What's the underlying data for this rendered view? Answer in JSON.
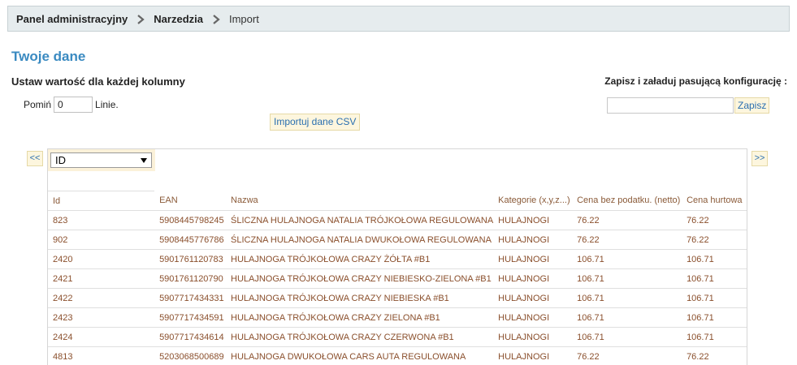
{
  "breadcrumb": {
    "items": [
      {
        "label": "Panel administracyjny",
        "bold": true
      },
      {
        "label": "Narzedzia",
        "bold": true
      },
      {
        "label": "Import",
        "bold": false
      }
    ]
  },
  "page_title": "Twoje dane",
  "columns_section": {
    "label": "Ustaw wartość dla każdej kolumny",
    "skip_prefix": "Pomiń",
    "skip_value": "0",
    "skip_suffix": "Linie."
  },
  "import_button": "Importuj dane CSV",
  "config": {
    "label": "Zapisz i załaduj pasującą konfigurację :",
    "input_value": "",
    "save_label": "Zapisz"
  },
  "navigation": {
    "prev_label": "<<",
    "next_label": ">>"
  },
  "column_select": {
    "selected": "ID"
  },
  "table": {
    "headers": [
      "Id",
      "EAN",
      "Nazwa",
      "Kategorie (x,y,z...)",
      "Cena bez podatku. (netto)",
      "Cena hurtowa"
    ],
    "rows": [
      [
        "823",
        "5908445798245",
        "ŚLICZNA HULAJNOGA NATALIA TRÓJKOŁOWA REGULOWANA",
        "HULAJNOGI",
        "76.22",
        "76.22"
      ],
      [
        "902",
        "5908445776786",
        "ŚLICZNA HULAJNOGA NATALIA DWUKOŁOWA REGULOWANA",
        "HULAJNOGI",
        "76.22",
        "76.22"
      ],
      [
        "2420",
        "5901761120783",
        "HULAJNOGA TRÓJKOŁOWA CRAZY ŻÓŁTA #B1",
        "HULAJNOGI",
        "106.71",
        "106.71"
      ],
      [
        "2421",
        "5901761120790",
        "HULAJNOGA TRÓJKOŁOWA CRAZY NIEBIESKO-ZIELONA #B1",
        "HULAJNOGI",
        "106.71",
        "106.71"
      ],
      [
        "2422",
        "5907717434331",
        "HULAJNOGA TRÓJKOŁOWA CRAZY NIEBIESKA #B1",
        "HULAJNOGI",
        "106.71",
        "106.71"
      ],
      [
        "2423",
        "5907717434591",
        "HULAJNOGA TRÓJKOŁOWA CRAZY ZIELONA #B1",
        "HULAJNOGI",
        "106.71",
        "106.71"
      ],
      [
        "2424",
        "5907717434614",
        "HULAJNOGA TRÓJKOŁOWA CRAZY CZERWONA #B1",
        "HULAJNOGI",
        "106.71",
        "106.71"
      ],
      [
        "4813",
        "5203068500689",
        "HULAJNOGA DWUKOŁOWA CARS AUTA REGULOWANA",
        "HULAJNOGI",
        "76.22",
        "76.22"
      ]
    ]
  },
  "colors": {
    "title": "#3a8ac1",
    "button_bg": "#fdf6de",
    "cell_text": "#8a4f2c",
    "breadcrumb_bg": "#e6ecee"
  }
}
